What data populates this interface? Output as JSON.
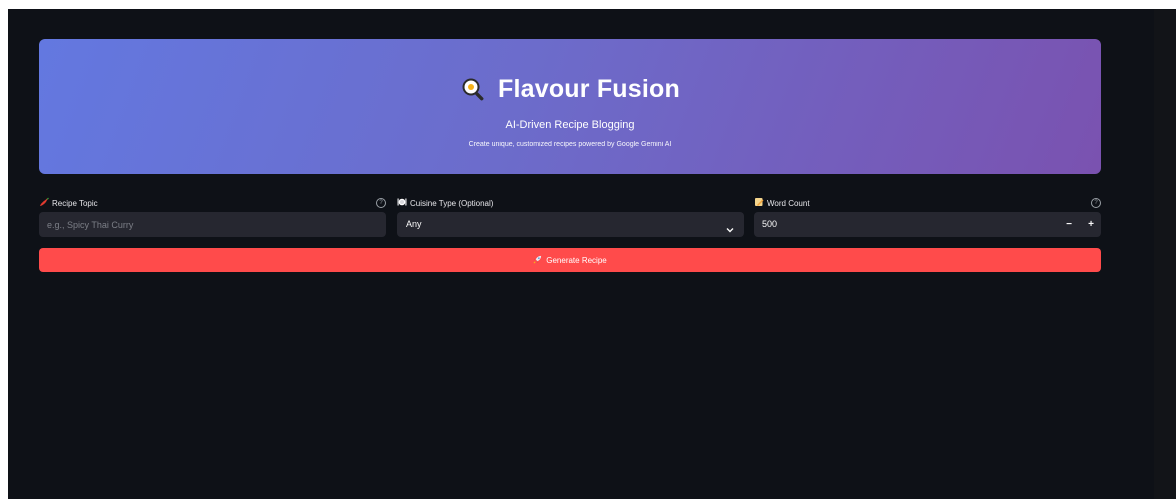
{
  "header": {
    "title": "Flavour Fusion",
    "subtitle": "AI-Driven Recipe Blogging",
    "description": "Create unique, customized recipes powered by Google Gemini AI",
    "icon": "frying-pan-egg-icon"
  },
  "form": {
    "topic": {
      "label": "Recipe Topic",
      "icon": "chili-pepper-icon",
      "placeholder": "e.g., Spicy Thai Curry",
      "value": ""
    },
    "cuisine": {
      "label": "Cuisine Type (Optional)",
      "icon": "plate-cutlery-icon",
      "selected": "Any"
    },
    "word_count": {
      "label": "Word Count",
      "icon": "memo-icon",
      "value": "500",
      "minus_label": "−",
      "plus_label": "+"
    }
  },
  "actions": {
    "generate_label": "Generate Recipe",
    "generate_icon": "rocket-icon"
  },
  "colors": {
    "background": "#0e1117",
    "input_bg": "#262730",
    "primary_button": "#ff4b4b",
    "hero_gradient_start": "#6378e0",
    "hero_gradient_end": "#7a52b0"
  }
}
